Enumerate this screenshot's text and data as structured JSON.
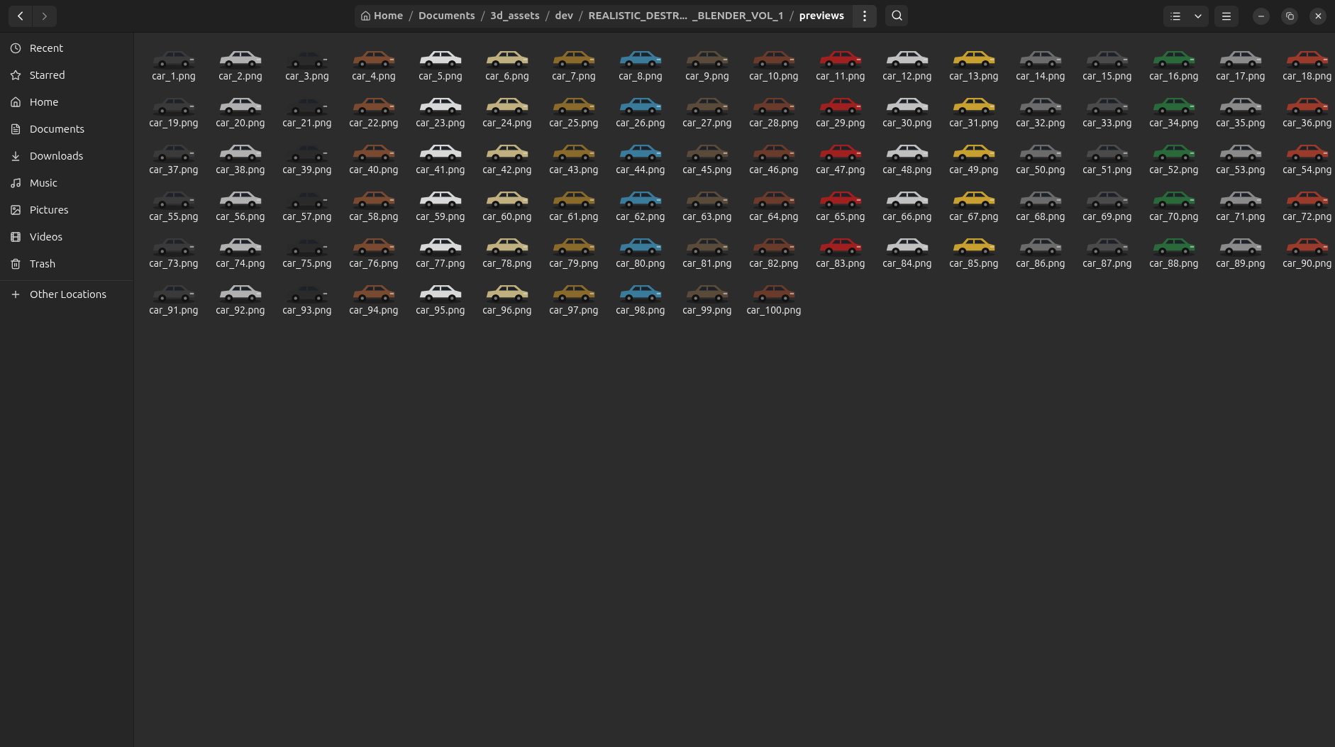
{
  "breadcrumbs": [
    {
      "label": "Home",
      "kind": "home",
      "current": false
    },
    {
      "separator": "/",
      "label": "Documents",
      "kind": "folder",
      "current": false
    },
    {
      "separator": "/",
      "label": "3d_assets",
      "kind": "folder",
      "current": false
    },
    {
      "separator": "/",
      "label": "dev",
      "kind": "folder",
      "current": false
    },
    {
      "separator": "/",
      "label": "REALISTIC_DESTR...  _BLENDER_VOL_1",
      "kind": "folder",
      "current": false
    },
    {
      "separator": "/",
      "label": "previews",
      "kind": "folder",
      "current": true
    }
  ],
  "sidebar": {
    "items": [
      {
        "label": "Recent",
        "kind": "recent"
      },
      {
        "label": "Starred",
        "kind": "starred"
      },
      {
        "label": "Home",
        "kind": "home"
      },
      {
        "label": "Documents",
        "kind": "documents"
      },
      {
        "label": "Downloads",
        "kind": "downloads"
      },
      {
        "label": "Music",
        "kind": "music"
      },
      {
        "label": "Pictures",
        "kind": "pictures"
      },
      {
        "label": "Videos",
        "kind": "videos"
      },
      {
        "label": "Trash",
        "kind": "trash"
      }
    ],
    "other": {
      "label": "Other Locations"
    }
  },
  "files": [
    {
      "name": "car_1.png"
    },
    {
      "name": "car_2.png"
    },
    {
      "name": "car_3.png"
    },
    {
      "name": "car_4.png"
    },
    {
      "name": "car_5.png"
    },
    {
      "name": "car_6.png"
    },
    {
      "name": "car_7.png"
    },
    {
      "name": "car_8.png"
    },
    {
      "name": "car_9.png"
    },
    {
      "name": "car_10.png"
    },
    {
      "name": "car_11.png"
    },
    {
      "name": "car_12.png"
    },
    {
      "name": "car_13.png"
    },
    {
      "name": "car_14.png"
    },
    {
      "name": "car_15.png"
    },
    {
      "name": "car_16.png"
    },
    {
      "name": "car_17.png"
    },
    {
      "name": "car_18.png"
    },
    {
      "name": "car_19.png"
    },
    {
      "name": "car_20.png"
    },
    {
      "name": "car_21.png"
    },
    {
      "name": "car_22.png"
    },
    {
      "name": "car_23.png"
    },
    {
      "name": "car_24.png"
    },
    {
      "name": "car_25.png"
    },
    {
      "name": "car_26.png"
    },
    {
      "name": "car_27.png"
    },
    {
      "name": "car_28.png"
    },
    {
      "name": "car_29.png"
    },
    {
      "name": "car_30.png"
    },
    {
      "name": "car_31.png"
    },
    {
      "name": "car_32.png"
    },
    {
      "name": "car_33.png"
    },
    {
      "name": "car_34.png"
    },
    {
      "name": "car_35.png"
    },
    {
      "name": "car_36.png"
    },
    {
      "name": "car_37.png"
    },
    {
      "name": "car_38.png"
    },
    {
      "name": "car_39.png"
    },
    {
      "name": "car_40.png"
    },
    {
      "name": "car_41.png"
    },
    {
      "name": "car_42.png"
    },
    {
      "name": "car_43.png"
    },
    {
      "name": "car_44.png"
    },
    {
      "name": "car_45.png"
    },
    {
      "name": "car_46.png"
    },
    {
      "name": "car_47.png"
    },
    {
      "name": "car_48.png"
    },
    {
      "name": "car_49.png"
    },
    {
      "name": "car_50.png"
    },
    {
      "name": "car_51.png"
    },
    {
      "name": "car_52.png"
    },
    {
      "name": "car_53.png"
    },
    {
      "name": "car_54.png"
    },
    {
      "name": "car_55.png"
    },
    {
      "name": "car_56.png"
    },
    {
      "name": "car_57.png"
    },
    {
      "name": "car_58.png"
    },
    {
      "name": "car_59.png"
    },
    {
      "name": "car_60.png"
    },
    {
      "name": "car_61.png"
    },
    {
      "name": "car_62.png"
    },
    {
      "name": "car_63.png"
    },
    {
      "name": "car_64.png"
    },
    {
      "name": "car_65.png"
    },
    {
      "name": "car_66.png"
    },
    {
      "name": "car_67.png"
    },
    {
      "name": "car_68.png"
    },
    {
      "name": "car_69.png"
    },
    {
      "name": "car_70.png"
    },
    {
      "name": "car_71.png"
    },
    {
      "name": "car_72.png"
    },
    {
      "name": "car_73.png"
    },
    {
      "name": "car_74.png"
    },
    {
      "name": "car_75.png"
    },
    {
      "name": "car_76.png"
    },
    {
      "name": "car_77.png"
    },
    {
      "name": "car_78.png"
    },
    {
      "name": "car_79.png"
    },
    {
      "name": "car_80.png"
    },
    {
      "name": "car_81.png"
    },
    {
      "name": "car_82.png"
    },
    {
      "name": "car_83.png"
    },
    {
      "name": "car_84.png"
    },
    {
      "name": "car_85.png"
    },
    {
      "name": "car_86.png"
    },
    {
      "name": "car_87.png"
    },
    {
      "name": "car_88.png"
    },
    {
      "name": "car_89.png"
    },
    {
      "name": "car_90.png"
    },
    {
      "name": "car_91.png"
    },
    {
      "name": "car_92.png"
    },
    {
      "name": "car_93.png"
    },
    {
      "name": "car_94.png"
    },
    {
      "name": "car_95.png"
    },
    {
      "name": "car_96.png"
    },
    {
      "name": "car_97.png"
    },
    {
      "name": "car_98.png"
    },
    {
      "name": "car_99.png"
    },
    {
      "name": "car_100.png"
    }
  ]
}
